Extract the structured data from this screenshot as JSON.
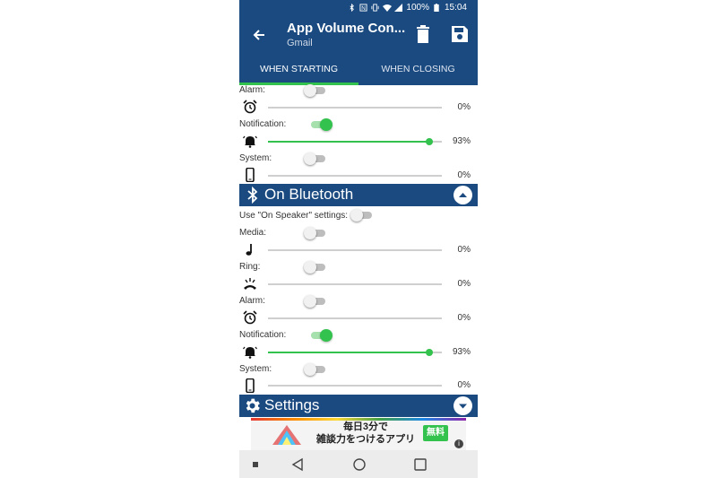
{
  "status_bar": {
    "battery": "100%",
    "time": "15:04"
  },
  "app_bar": {
    "title": "App Volume Con...",
    "subtitle": "Gmail"
  },
  "tabs": [
    {
      "label": "WHEN STARTING",
      "active": true
    },
    {
      "label": "WHEN CLOSING",
      "active": false
    }
  ],
  "top_rows": [
    {
      "label": "Alarm:",
      "toggle_on": false,
      "icon": "alarm-clock-icon",
      "value_text": "0%",
      "level": 0
    },
    {
      "label": "Notification:",
      "toggle_on": true,
      "icon": "notification-bell-icon",
      "value_text": "93%",
      "level": 0.93
    },
    {
      "label": "System:",
      "toggle_on": false,
      "icon": "phone-icon",
      "value_text": "0%",
      "level": 0
    }
  ],
  "bluetooth_section": {
    "title": "On Bluetooth",
    "icon": "bluetooth-icon",
    "expanded": true,
    "use_speaker_label": "Use \"On Speaker\" settings:",
    "use_speaker_on": false,
    "rows": [
      {
        "label": "Media:",
        "toggle_on": false,
        "icon": "music-note-icon",
        "value_text": "0%",
        "level": 0
      },
      {
        "label": "Ring:",
        "toggle_on": false,
        "icon": "ringing-phone-icon",
        "value_text": "0%",
        "level": 0
      },
      {
        "label": "Alarm:",
        "toggle_on": false,
        "icon": "alarm-clock-icon",
        "value_text": "0%",
        "level": 0
      },
      {
        "label": "Notification:",
        "toggle_on": true,
        "icon": "notification-bell-icon",
        "value_text": "93%",
        "level": 0.93
      },
      {
        "label": "System:",
        "toggle_on": false,
        "icon": "phone-icon",
        "value_text": "0%",
        "level": 0
      }
    ]
  },
  "settings_section": {
    "title": "Settings",
    "icon": "gear-icon",
    "expanded": false
  },
  "ad": {
    "text_line1": "毎日3分で",
    "text_line2": "雑談力をつけるアプリ",
    "button_label": "無料",
    "info": "i"
  },
  "colors": {
    "primary": "#1a4a80",
    "accent": "#33c24d",
    "track": "#cfcfcf"
  }
}
